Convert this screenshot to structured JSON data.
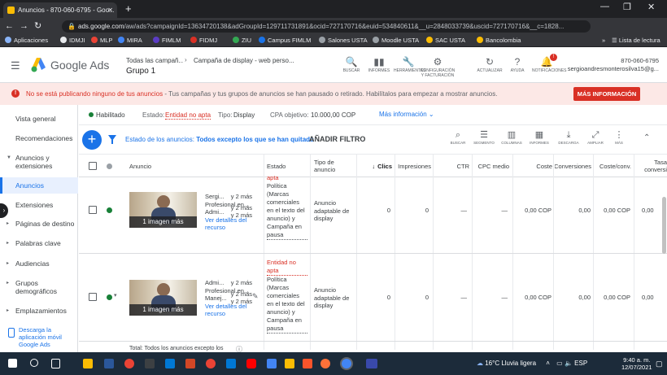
{
  "browser": {
    "tab_title": "Anuncios - 870-060-6795 - Goo...",
    "new_tab": "+",
    "url_host": "ads.google.com",
    "url_path": "/aw/ads?campaignId=13634720138&adGroupId=129711731891&ocid=727170716&euid=534840611&__u=2848033739&uscid=727170716&__c=1828...",
    "window_controls": [
      "—",
      "❐",
      "✕"
    ],
    "bookmarks": [
      {
        "label": "Aplicaciones",
        "color": "#8ab4f8"
      },
      {
        "label": "IDMJI",
        "color": "#e8eaed"
      },
      {
        "label": "MLP",
        "color": "#ea4335"
      },
      {
        "label": "MIRA",
        "color": "#4285f4"
      },
      {
        "label": "FIMLM",
        "color": "#5b3cc4"
      },
      {
        "label": "FIDMJ",
        "color": "#d93025"
      },
      {
        "label": "ZIU",
        "color": "#34a853"
      },
      {
        "label": "Campus FIMLM",
        "color": "#1a73e8"
      },
      {
        "label": "Salones USTA",
        "color": "#9aa0a6"
      },
      {
        "label": "Moodle USTA",
        "color": "#9aa0a6"
      },
      {
        "label": "SAC USTA",
        "color": "#fbbc04"
      },
      {
        "label": "Bancolombia",
        "color": "#fbbc04"
      }
    ],
    "reading_list": "Lista de lectura"
  },
  "ads_header": {
    "brand": "Google Ads",
    "breadcrumb_1": "Todas las campañ...",
    "breadcrumb_2": "Campaña de display - web perso...",
    "group": "Grupo 1",
    "tools": [
      {
        "label": "BUSCAR",
        "icon": "search-icon",
        "glyph": "🔍"
      },
      {
        "label": "INFORMES",
        "icon": "reports-icon",
        "glyph": "▮▮"
      },
      {
        "label": "HERRAMIENTAS",
        "icon": "wrench-icon",
        "glyph": "🔧"
      },
      {
        "label": "CONFIGURACIÓN Y FACTURACIÓN",
        "icon": "gear-icon",
        "glyph": "⚙"
      },
      {
        "label": "ACTUALIZAR",
        "icon": "refresh-icon",
        "glyph": "↻"
      },
      {
        "label": "AYUDA",
        "icon": "help-icon",
        "glyph": "?"
      },
      {
        "label": "NOTIFICACIONES",
        "icon": "bell-icon",
        "glyph": "🔔"
      }
    ],
    "notification_badge": "!",
    "account_id": "870-060-6795",
    "account_email": "sergioandresmonterosilva15@g..."
  },
  "alert": {
    "title": "No se está publicando ninguno de tus anuncios",
    "message": " - Tus campañas y tus grupos de anuncios se han pausado o retirado. Habilítalos para empezar a mostrar anuncios.",
    "button": "MÁS INFORMACIÓN"
  },
  "sidebar": {
    "items": [
      {
        "label": "Vista general",
        "caret": ""
      },
      {
        "label": "Recomendaciones",
        "caret": ""
      },
      {
        "label": "Anuncios y extensiones",
        "caret": "▼"
      },
      {
        "label": "Anuncios",
        "caret": ""
      },
      {
        "label": "Extensiones",
        "caret": ""
      },
      {
        "label": "Páginas de destino",
        "caret": "▸"
      },
      {
        "label": "Palabras clave",
        "caret": "▸"
      },
      {
        "label": "Audiencias",
        "caret": "▸"
      },
      {
        "label": "Grupos demográficos",
        "caret": "▸"
      },
      {
        "label": "Emplazamientos",
        "caret": "▸"
      }
    ],
    "download": "Descarga la aplicación móvil Google Ads"
  },
  "status": {
    "enabled": "Habilitado",
    "state_label": "Estado:",
    "state_value": "Entidad no apta",
    "type_label": "Tipo:",
    "type_value": "Display",
    "cpa_label": "CPA objetivo:",
    "cpa_value": "10.000,00 COP",
    "more_info": "Más información"
  },
  "filter": {
    "prefix": "Estado de los anuncios:",
    "value": "Todos excepto los que se han quitado",
    "add": "AÑADIR FILTRO",
    "tools": [
      "BUSCAR",
      "SEGMENTO",
      "COLUMNAS",
      "INFORMES",
      "DESCARGA",
      "AMPLIAR",
      "MÁS"
    ]
  },
  "columns": [
    "Anuncio",
    "Estado",
    "Tipo de anuncio",
    "Clics",
    "Impresiones",
    "CTR",
    "CPC medio",
    "Coste",
    "Conversiones",
    "Coste/conv.",
    "Tasa conversi"
  ],
  "rows": [
    {
      "ad_lines": [
        "Sergi...",
        "Profesional en...",
        "Admi..."
      ],
      "more_lines": [
        "y 2 más",
        "y 2 más",
        "y 2 más"
      ],
      "details": "Ver detalles del recurso",
      "image_label": "1 imagen más",
      "state_top": "apta",
      "state_rest": "Política (Marcas comerciales en el texto del anuncio) y Campaña en pausa",
      "type": "Anuncio adaptable de display",
      "clicks": "0",
      "impressions": "0",
      "ctr": "—",
      "cpc": "—",
      "cost": "0,00 COP",
      "conversions": "0,00",
      "cost_conv": "0,00 COP",
      "conv_rate": "0,00"
    },
    {
      "ad_lines": [
        "Admi...",
        "Profesional en...",
        "Manej..."
      ],
      "more_lines": [
        "y 2 más",
        "y 2 más",
        "y 2 más"
      ],
      "details": "Ver detalles del recurso",
      "image_label": "1 imagen más",
      "state_top": "Entidad no apta",
      "state_rest": "Política (Marcas comerciales en el texto del anuncio) y Campaña en pausa",
      "type": "Anuncio adaptable de display",
      "clicks": "0",
      "impressions": "0",
      "ctr": "—",
      "cpc": "—",
      "cost": "0,00 COP",
      "conversions": "0,00",
      "cost_conv": "0,00 COP",
      "conv_rate": "0,00"
    }
  ],
  "total_row": "Total: Todos los anuncios excepto los",
  "taskbar": {
    "weather": "16°C  Lluvia ligera",
    "lang": "ESP",
    "time": "9:40 a. m.",
    "date": "12/07/2021"
  }
}
